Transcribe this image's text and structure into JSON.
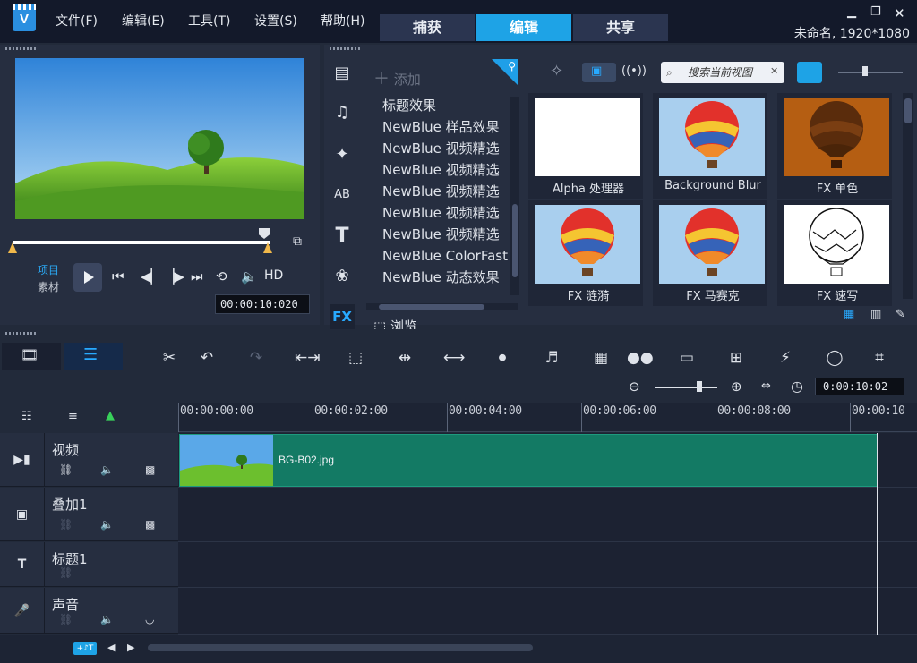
{
  "menubar": {
    "logo": "V",
    "items": [
      "文件(F)",
      "编辑(E)",
      "工具(T)",
      "设置(S)",
      "帮助(H)"
    ],
    "mode_tabs": [
      "捕获",
      "编辑",
      "共享"
    ],
    "active_tab": "编辑",
    "project_title": "未命名, 1920*1080"
  },
  "player": {
    "mode_project": "项目",
    "mode_clip": "素材",
    "quality": "HD",
    "timecode": "00:00:10:020"
  },
  "library": {
    "add_label": "添加",
    "effects": [
      "标题效果",
      "NewBlue 样品效果",
      "NewBlue 视频精选",
      "NewBlue 视频精选",
      "NewBlue 视频精选",
      "NewBlue 视频精选",
      "NewBlue 视频精选",
      "NewBlue ColorFast",
      "NewBlue 动态效果"
    ],
    "browse_label": "浏览",
    "fx_label": "FX",
    "search_placeholder": "搜索当前视图",
    "tiles": [
      {
        "label": "Alpha 处理器",
        "kind": "blank"
      },
      {
        "label": "Background Blur",
        "kind": "balloon"
      },
      {
        "label": "FX 单色",
        "kind": "sepia"
      },
      {
        "label": "FX 涟漪",
        "kind": "balloon"
      },
      {
        "label": "FX 马赛克",
        "kind": "balloon"
      },
      {
        "label": "FX 速写",
        "kind": "sketch"
      }
    ]
  },
  "timeline": {
    "zoom_timecode": "0:00:10:02",
    "ruler": [
      "00:00:00:00",
      "00:00:02:00",
      "00:00:04:00",
      "00:00:06:00",
      "00:00:08:00",
      "00:00:10"
    ],
    "tracks": [
      "视频",
      "叠加1",
      "标题1",
      "声音"
    ],
    "clip_name": "BG-B02.jpg",
    "track_add_label": "+♪T"
  }
}
